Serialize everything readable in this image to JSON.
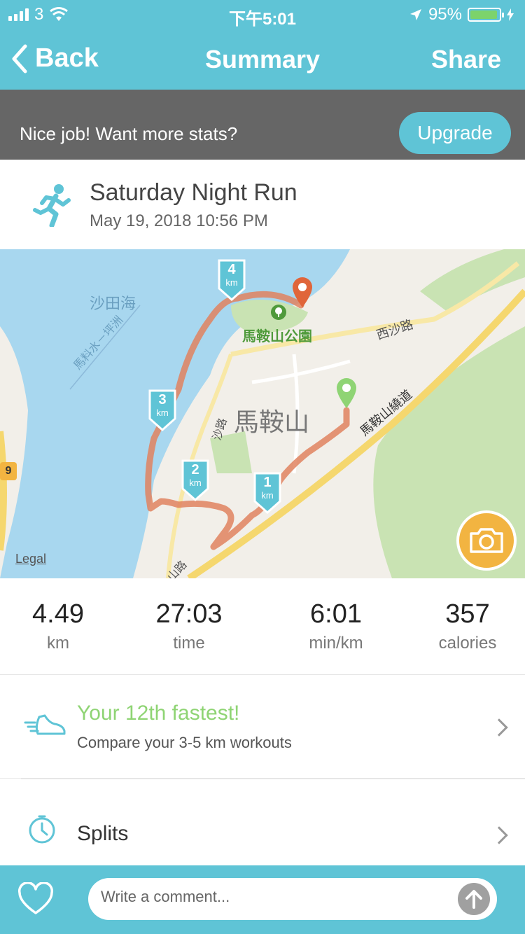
{
  "status_bar": {
    "carrier": "3",
    "time": "下午5:01",
    "battery_percent": "95%",
    "battery_level": 0.95
  },
  "nav": {
    "back_label": "Back",
    "title": "Summary",
    "share_label": "Share"
  },
  "banner": {
    "message": "Nice job! Want more stats?",
    "upgrade_label": "Upgrade"
  },
  "run": {
    "name": "Saturday Night Run",
    "datetime": "May 19, 2018 10:56 PM",
    "icon": "runner-icon"
  },
  "map": {
    "labels": {
      "sea": "沙田海",
      "park": "馬鞍山公園",
      "district": "馬鞍山",
      "road_west": "西沙路",
      "road_bypass": "馬鞍山繞道",
      "waterway": "馬料水－坪洲",
      "road_sha": "沙路",
      "road_mos": "山路",
      "route_no": "9"
    },
    "km_markers": [
      "1",
      "2",
      "3",
      "4"
    ],
    "km_unit": "km",
    "legal": "Legal"
  },
  "stats": [
    {
      "value": "4.49",
      "unit": "km"
    },
    {
      "value": "27:03",
      "unit": "time"
    },
    {
      "value": "6:01",
      "unit": "min/km"
    },
    {
      "value": "357",
      "unit": "calories"
    }
  ],
  "rank": {
    "title": "Your 12th fastest!",
    "subtitle": "Compare your 3-5 km workouts"
  },
  "splits": {
    "label": "Splits"
  },
  "comment": {
    "placeholder": "Write a comment..."
  },
  "colors": {
    "accent": "#5fc4d6",
    "route": "#e0825f",
    "highlight": "#8fd474",
    "camera": "#f2b441"
  }
}
